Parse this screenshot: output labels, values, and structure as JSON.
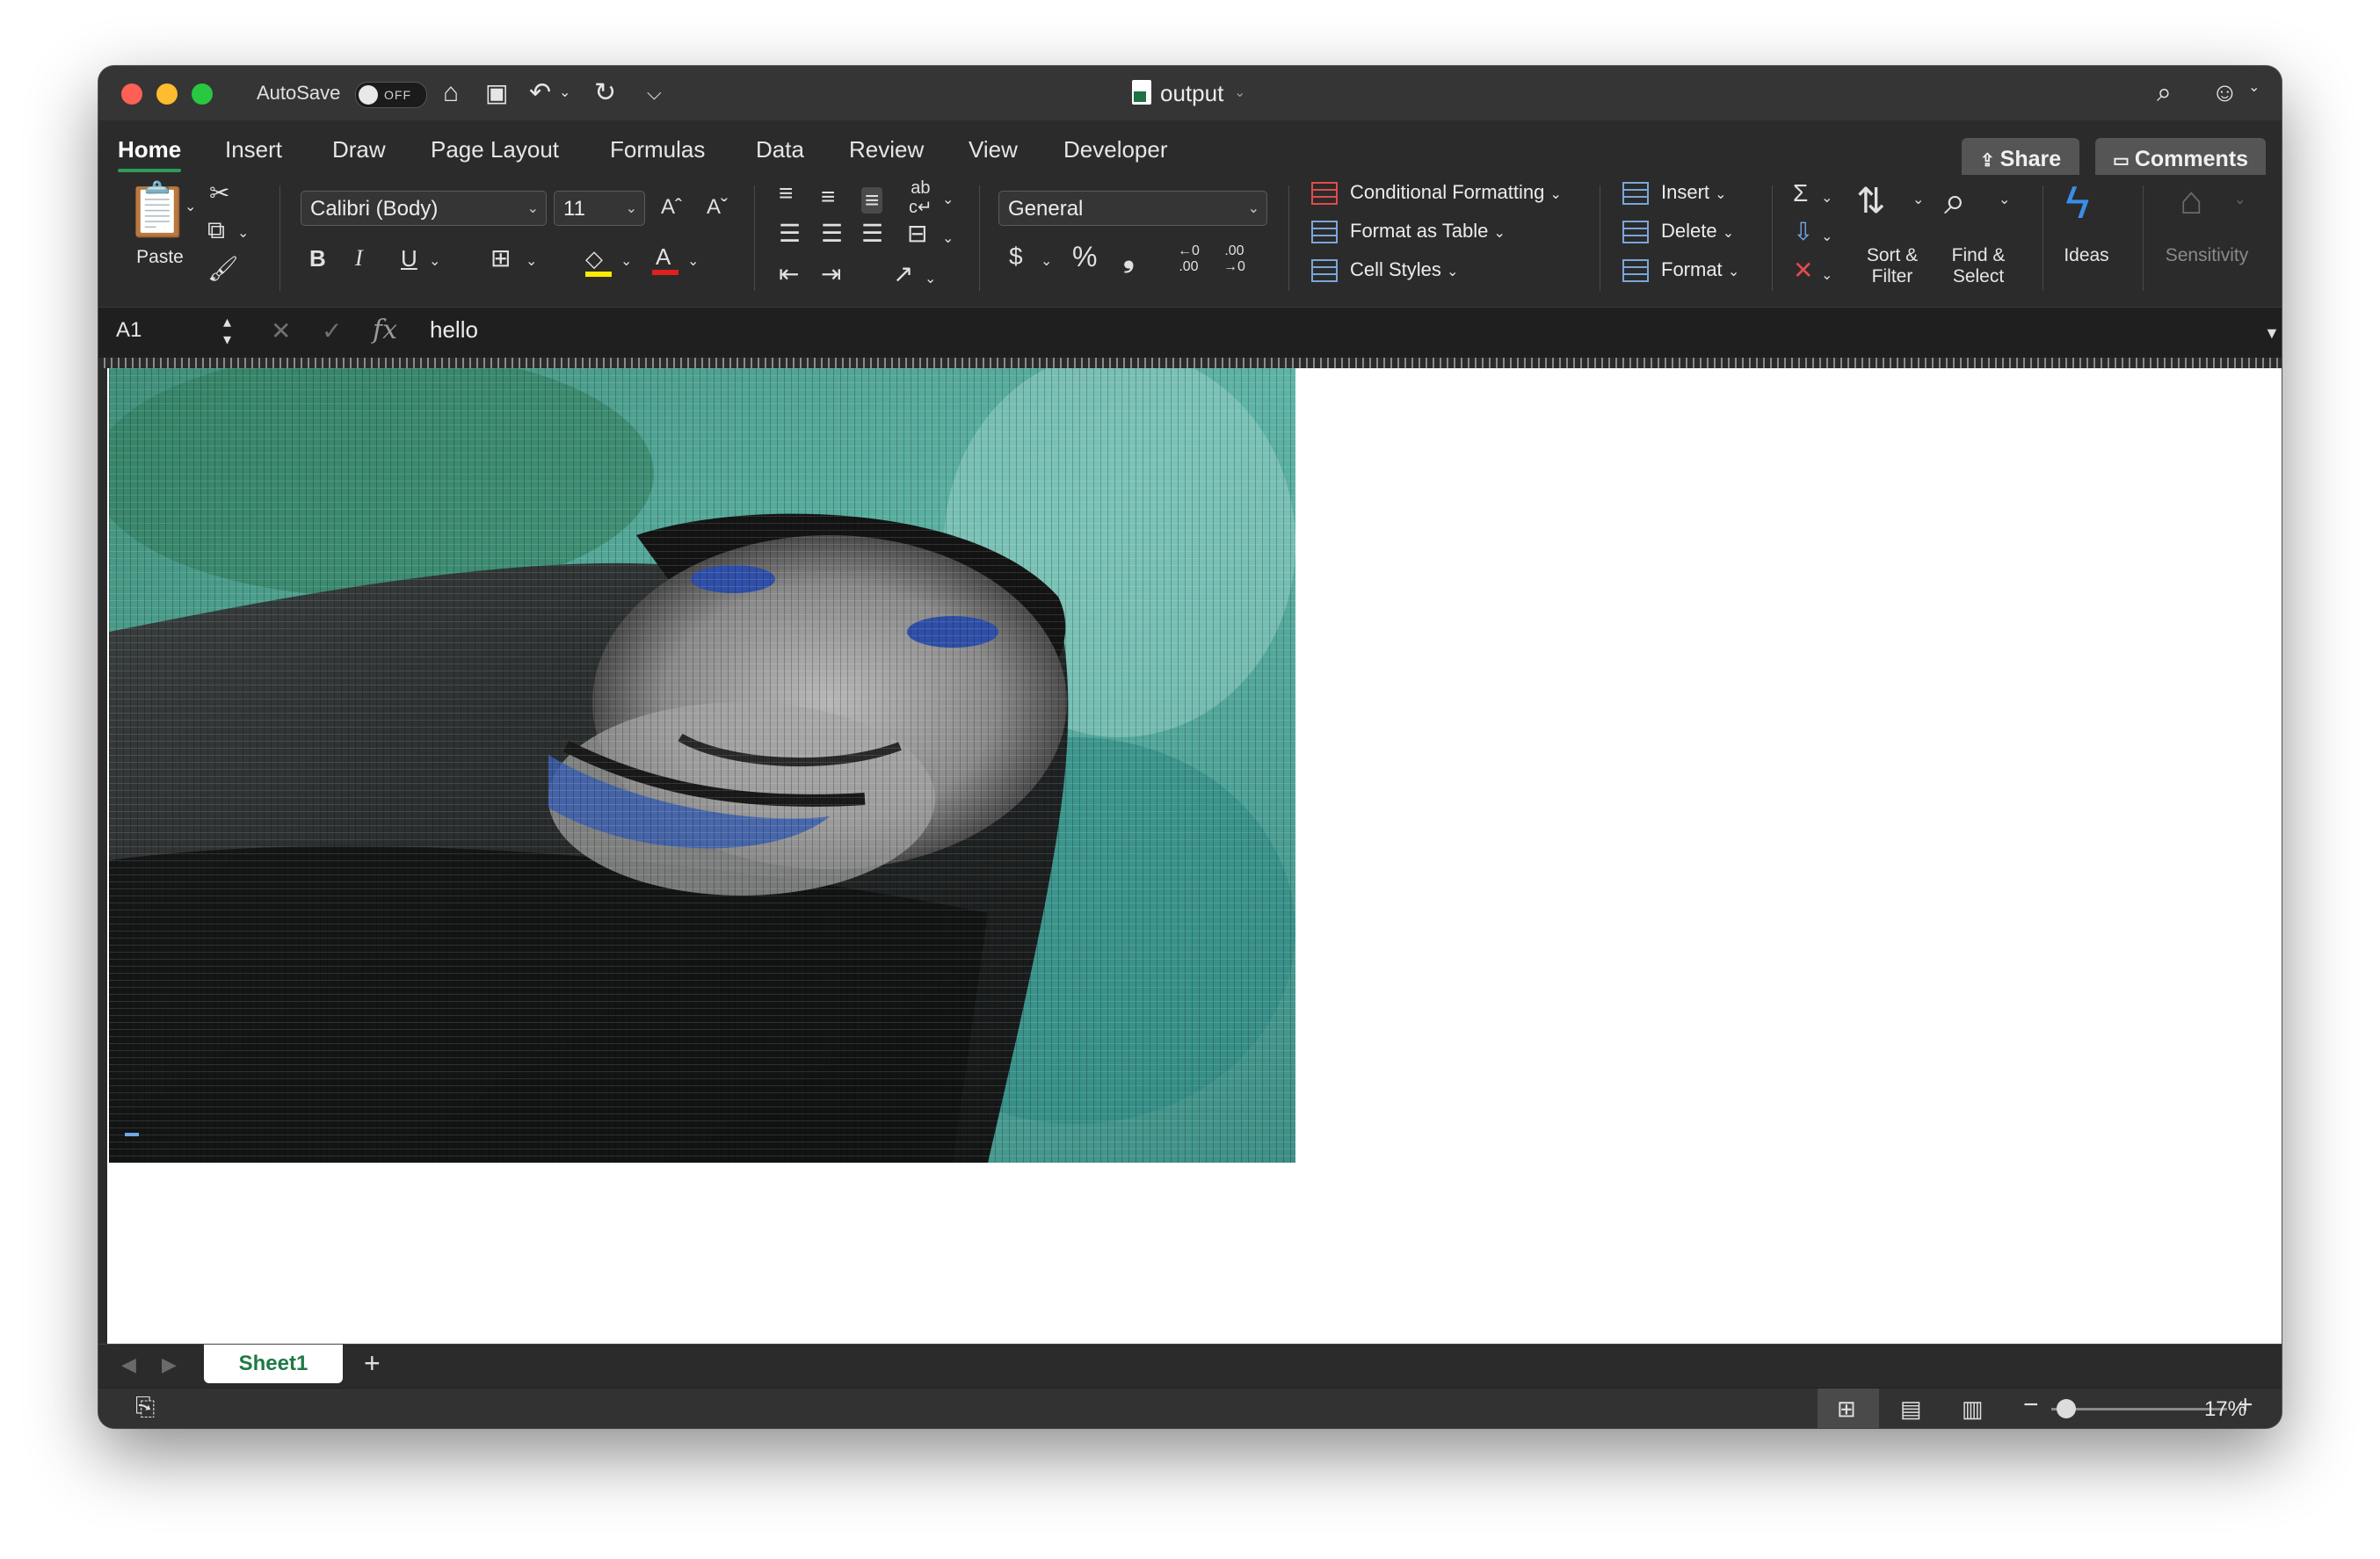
{
  "titlebar": {
    "autosave_label": "AutoSave",
    "autosave_state": "OFF",
    "document_title": "output"
  },
  "tabs": [
    {
      "label": "Home",
      "active": true
    },
    {
      "label": "Insert"
    },
    {
      "label": "Draw"
    },
    {
      "label": "Page Layout"
    },
    {
      "label": "Formulas"
    },
    {
      "label": "Data"
    },
    {
      "label": "Review"
    },
    {
      "label": "View"
    },
    {
      "label": "Developer"
    }
  ],
  "tab_buttons": {
    "share": "Share",
    "comments": "Comments"
  },
  "ribbon": {
    "paste_label": "Paste",
    "font_name": "Calibri (Body)",
    "font_size": "11",
    "bold": "B",
    "italic": "I",
    "underline": "U",
    "number_format": "General",
    "currency": "$",
    "percent": "%",
    "comma": "❟",
    "conditional_formatting": "Conditional Formatting",
    "format_as_table": "Format as Table",
    "cell_styles": "Cell Styles",
    "insert": "Insert",
    "delete": "Delete",
    "format": "Format",
    "sort_filter": "Sort &\nFilter",
    "find_select": "Find &\nSelect",
    "ideas": "Ideas",
    "sensitivity": "Sensitivity"
  },
  "formula_bar": {
    "name_box": "A1",
    "fx": "fx",
    "value": "hello"
  },
  "sheets": [
    {
      "label": "Sheet1",
      "active": true
    }
  ],
  "status": {
    "zoom": "17%"
  },
  "colors": {
    "accent_green": "#2e9b59",
    "window_bg": "#2b2b2b"
  }
}
